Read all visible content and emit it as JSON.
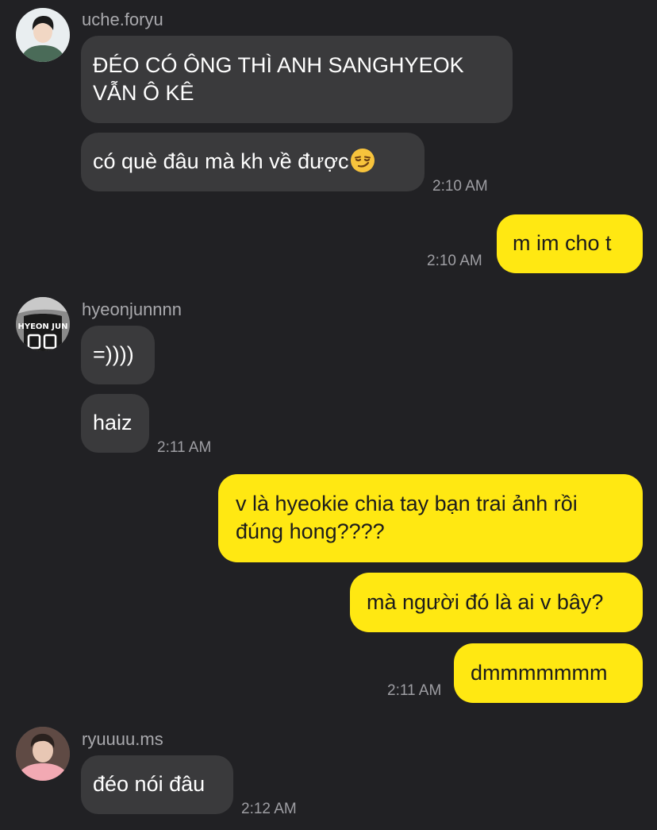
{
  "messages": [
    {
      "sender": "uche.foryu",
      "avatar": "user-avatar-photo",
      "bubbles": [
        "ĐÉO CÓ ÔNG THÌ ANH SANGHYEOK",
        "VẪN Ô KÊ",
        "có què đâu mà kh về được"
      ],
      "emoji": "smirking-face-emoji",
      "time": "2:10 AM"
    },
    {
      "sender": "me",
      "bubbles": [
        "m im cho t"
      ],
      "time": "2:10 AM"
    },
    {
      "sender": "hyeonjunnnn",
      "avatar": "user-avatar-photo",
      "avatar_print": "HYEON JUN",
      "bubbles": [
        "=))))",
        "haiz"
      ],
      "time": "2:11 AM"
    },
    {
      "sender": "me",
      "bubbles": [
        "v là hyeokie chia tay bạn trai ảnh rồi",
        "đúng hong????",
        "mà người đó là ai v bây?",
        "dmmmmmmm"
      ],
      "time": "2:11 AM"
    },
    {
      "sender": "ryuuuu.ms",
      "avatar": "user-avatar-photo",
      "bubbles": [
        "đéo nói đâu"
      ],
      "time": "2:12 AM"
    }
  ],
  "colors": {
    "background": "#212124",
    "incoming_bubble": "#3a3a3c",
    "outgoing_bubble": "#ffe812",
    "timestamp": "#9e9ea3",
    "sender_name": "#a9a9ad"
  }
}
